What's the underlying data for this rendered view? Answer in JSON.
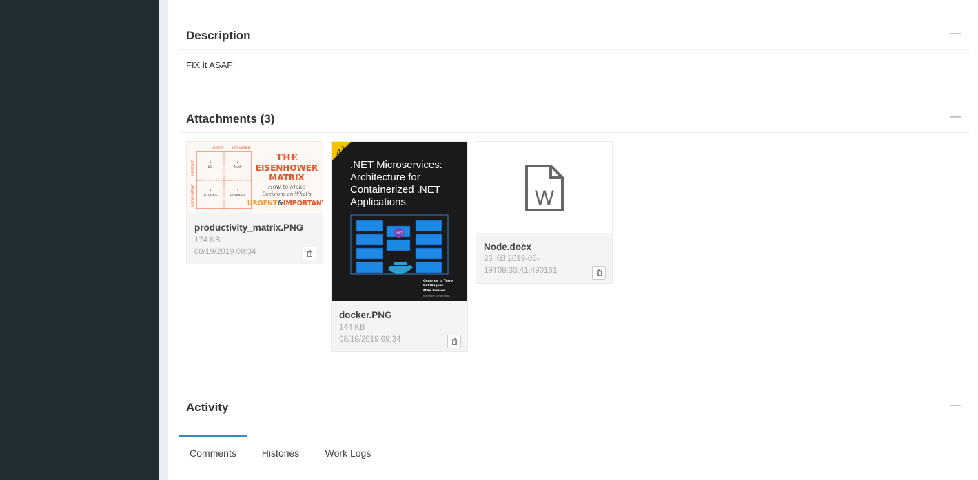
{
  "sections": {
    "description": {
      "title": "Description",
      "collapse_icon": "minus-icon",
      "text": "FIX it ASAP"
    },
    "attachments": {
      "title": "Attachments (3)",
      "collapse_icon": "minus-icon",
      "items": [
        {
          "name": "productivity_matrix.PNG",
          "size": "174 KB",
          "date": "08/19/2019 09:34",
          "thumb": {
            "urgent": "URGENT",
            "not_urgent": "NOT URGENT",
            "important": "IMPORTANT",
            "not_important": "NOT IMPORTANT",
            "q1_num": "1",
            "q1_label": "DO",
            "q2_num": "2",
            "q2_label": "PLAN",
            "q3_num": "3",
            "q3_label": "DELEGATE",
            "q4_num": "4",
            "q4_label": "ELIMINATE",
            "title_the": "THE",
            "title_1": "EISENHOWER",
            "title_2": "MATRIX",
            "subtitle_1": "How to Make",
            "subtitle_2": "Decisions on What's",
            "tagline_a": "URGENT",
            "tagline_amp": "&",
            "tagline_b": "IMPORTANT"
          }
        },
        {
          "name": "docker.PNG",
          "size": "144 KB",
          "date": "08/19/2019 09:34",
          "thumb": {
            "badge": "v2.1",
            "title_1": ".NET Microservices:",
            "title_2": "Architecture for",
            "title_3": "Containerized .NET",
            "title_4": "Applications",
            "net_badge": ".NET",
            "author_1": "Cesar de la Torre",
            "author_2": "Bill Wagner",
            "author_3": "Mike Rousos",
            "publisher": "Microsoft Corporation"
          }
        },
        {
          "name": "Node.docx",
          "meta_1": "26 KB 2019-08-",
          "meta_2": "19T09:33:41.490161",
          "icon": "word-document-icon",
          "icon_letter": "W"
        }
      ]
    },
    "activity": {
      "title": "Activity",
      "collapse_icon": "minus-icon",
      "tabs": [
        {
          "label": "Comments",
          "active": true
        },
        {
          "label": "Histories",
          "active": false
        },
        {
          "label": "Work Logs",
          "active": false
        }
      ]
    }
  },
  "colors": {
    "sidebar": "#222d32",
    "accent": "#3c8dbc",
    "eisenhower_red": "#e8542c",
    "eisenhower_orange": "#f29b38",
    "docker_bg": "#1c1c1c",
    "docker_blue": "#1e88e5"
  }
}
